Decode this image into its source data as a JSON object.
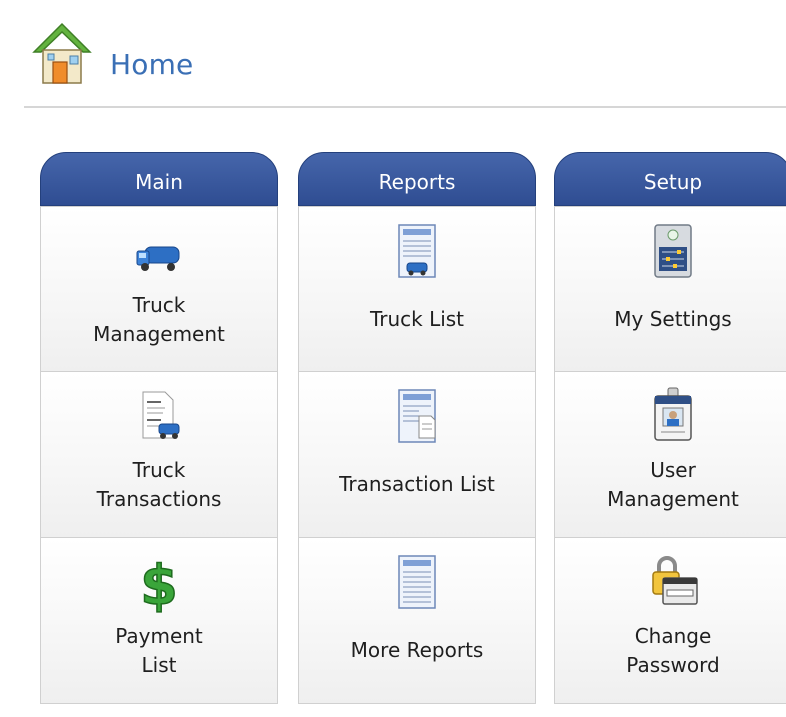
{
  "header": {
    "title": "Home",
    "icon": "home-icon"
  },
  "columns": [
    {
      "title": "Main",
      "tiles": [
        {
          "label": "Truck\nManagement",
          "icon": "truck-icon"
        },
        {
          "label": "Truck\nTransactions",
          "icon": "truck-document-icon"
        },
        {
          "label": "Payment\nList",
          "icon": "dollar-icon"
        }
      ]
    },
    {
      "title": "Reports",
      "tiles": [
        {
          "label": "Truck List",
          "icon": "report-truck-icon"
        },
        {
          "label": "Transaction List",
          "icon": "report-transaction-icon"
        },
        {
          "label": "More Reports",
          "icon": "report-icon"
        }
      ]
    },
    {
      "title": "Setup",
      "tiles": [
        {
          "label": "My Settings",
          "icon": "settings-icon"
        },
        {
          "label": "User\nManagement",
          "icon": "user-badge-icon"
        },
        {
          "label": "Change\nPassword",
          "icon": "lock-password-icon"
        }
      ]
    }
  ],
  "colors": {
    "header_gradient_top": "#4666ab",
    "header_gradient_bottom": "#2f4d92",
    "title_blue": "#3a6fb5"
  }
}
